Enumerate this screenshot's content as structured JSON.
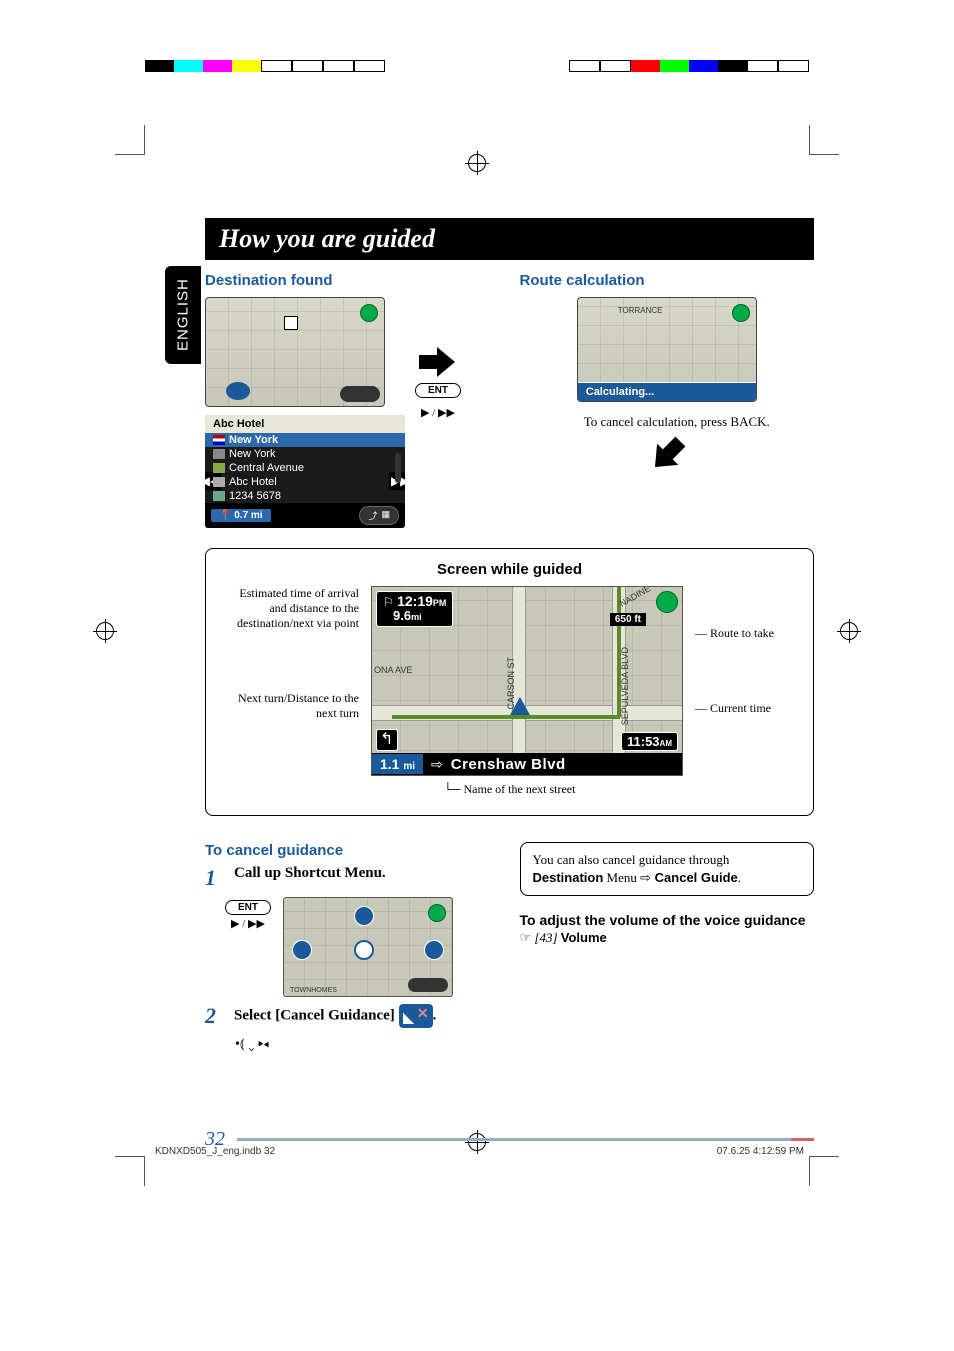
{
  "language_tab": "ENGLISH",
  "page_title": "How you are guided",
  "sections": {
    "destination_found": "Destination found",
    "route_calculation": "Route calculation",
    "cancel_calc_note": "To cancel calculation, press BACK.",
    "calc_status": "Calculating...",
    "torrance_label": "TORRANCE"
  },
  "info_card": {
    "title": "Abc Hotel",
    "lines": {
      "country": "New York",
      "city": "New York",
      "street": "Central Avenue",
      "name": "Abc Hotel",
      "phone": "1234 5678"
    },
    "distance": "0.7 mi"
  },
  "ent_button": "ENT",
  "play_nav_glyphs": "▶ / ▶▶",
  "guided": {
    "box_title": "Screen while guided",
    "eta_label_left": "Estimated time of arrival and distance to the destination/next via point",
    "turn_label_left": "Next turn/Distance to the next turn",
    "route_label_right": "Route to take",
    "time_label_right": "Current time",
    "street_label_bottom": "Name of the next street",
    "eta_time": "12:19",
    "eta_time_suffix": "PM",
    "eta_dist": "9.6",
    "eta_dist_unit": "mi",
    "scale": "650 ft",
    "current_time": "11:53",
    "current_time_suffix": "AM",
    "turn_distance": "1.1",
    "turn_distance_unit": "mi",
    "next_street": "Crenshaw Blvd",
    "street_ona": "ONA AVE",
    "street_carson": "CARSON ST",
    "street_sepulveda": "SEPULVEDA BLVD",
    "street_nadine": "NADINE"
  },
  "cancel_guidance": {
    "heading": "To cancel guidance",
    "step1": "Call up Shortcut Menu.",
    "step2_prefix": "Select [Cancel Guidance] ",
    "step2_suffix": "."
  },
  "callout": {
    "text_prefix": "You can also cancel guidance through ",
    "dest_menu": "Destination",
    "menu_word": " Menu ",
    "arrow": "⇨",
    "cancel_guide": " Cancel Guide",
    "period": "."
  },
  "volume": {
    "heading": "To adjust the volume of the voice guidance",
    "pointer": "☞",
    "ref": " [43] ",
    "term": "Volume"
  },
  "page_number": "32",
  "footer": {
    "left": "KDNXD505_J_eng.indb   32",
    "right": "07.6.25   4:12:59 PM"
  },
  "map_labels": {
    "townhomes": "TOWNHOMES"
  }
}
